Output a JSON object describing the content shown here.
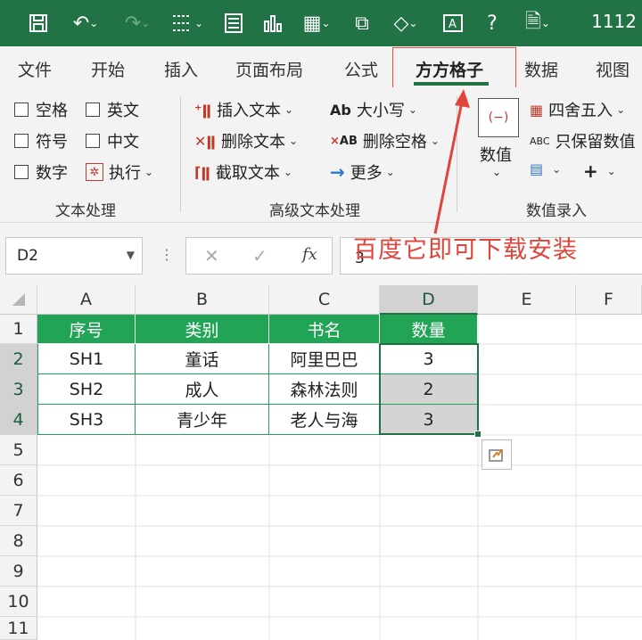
{
  "qat": {
    "counter": "1112"
  },
  "tabs": [
    "文件",
    "开始",
    "插入",
    "页面布局",
    "公式",
    "方方格子",
    "数据",
    "视图"
  ],
  "active_tab": "方方格子",
  "ribbon": {
    "checkboxes": [
      "空格",
      "英文",
      "符号",
      "中文",
      "数字"
    ],
    "exec_label": "执行",
    "group1": "文本处理",
    "adv": [
      "插入文本",
      "删除文本",
      "截取文本"
    ],
    "case_label": "大小写",
    "del_space": "删除空格",
    "more": "更多",
    "group2": "高级文本处理",
    "round": "四舍五入",
    "keep_num": "只保留数值",
    "numval": "数值",
    "group3": "数值录入"
  },
  "formula_bar": {
    "namebox": "D2",
    "fx": "fx",
    "value": "3"
  },
  "annotation": "百度它即可下载安装",
  "columns": [
    "A",
    "B",
    "C",
    "D",
    "E",
    "F"
  ],
  "rows": [
    "1",
    "2",
    "3",
    "4",
    "5",
    "6",
    "7",
    "8",
    "9",
    "10",
    "11"
  ],
  "table": {
    "headers": [
      "序号",
      "类别",
      "书名",
      "数量"
    ],
    "rows": [
      [
        "SH1",
        "童话",
        "阿里巴巴",
        "3"
      ],
      [
        "SH2",
        "成人",
        "森林法则",
        "2"
      ],
      [
        "SH3",
        "青少年",
        "老人与海",
        "3"
      ]
    ]
  },
  "colors": {
    "excel_green": "#217346",
    "header_fill": "#21a456",
    "annotation_red": "#e0443b"
  }
}
